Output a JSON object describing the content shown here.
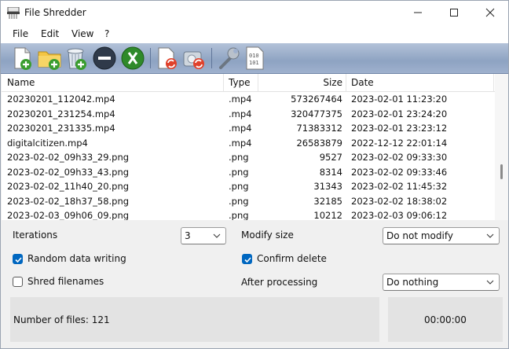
{
  "window": {
    "title": "File Shredder"
  },
  "menu": [
    "File",
    "Edit",
    "View",
    "?"
  ],
  "toolbar": {
    "buttons": [
      "add-file-icon",
      "add-folder-icon",
      "add-recycle-bin-icon",
      "remove-icon",
      "clear-list-icon",
      "shred-files-icon",
      "shred-free-space-icon",
      "settings-wrench-icon",
      "binary-file-icon"
    ]
  },
  "list": {
    "columns": {
      "name": "Name",
      "type": "Type",
      "size": "Size",
      "date": "Date"
    },
    "rows": [
      {
        "name": "20230201_112042.mp4",
        "type": ".mp4",
        "size": "573267464",
        "date": "2023-02-01 11:23:20"
      },
      {
        "name": "20230201_231254.mp4",
        "type": ".mp4",
        "size": "320477375",
        "date": "2023-02-01 23:24:20"
      },
      {
        "name": "20230201_231335.mp4",
        "type": ".mp4",
        "size": "71383312",
        "date": "2023-02-01 23:23:12"
      },
      {
        "name": "digitalcitizen.mp4",
        "type": ".mp4",
        "size": "26583879",
        "date": "2022-12-12 22:01:14"
      },
      {
        "name": "2023-02-02_09h33_29.png",
        "type": ".png",
        "size": "9527",
        "date": "2023-02-02 09:33:30"
      },
      {
        "name": "2023-02-02_09h33_43.png",
        "type": ".png",
        "size": "8314",
        "date": "2023-02-02 09:33:46"
      },
      {
        "name": "2023-02-02_11h40_20.png",
        "type": ".png",
        "size": "31343",
        "date": "2023-02-02 11:45:32"
      },
      {
        "name": "2023-02-02_18h37_58.png",
        "type": ".png",
        "size": "32185",
        "date": "2023-02-02 18:38:02"
      },
      {
        "name": "2023-02-03_09h06_09.png",
        "type": ".png",
        "size": "10212",
        "date": "2023-02-03 09:06:12"
      }
    ]
  },
  "options": {
    "iterations_label": "Iterations",
    "iterations_value": "3",
    "random_label": "Random data writing",
    "random_checked": true,
    "shred_names_label": "Shred filenames",
    "shred_names_checked": false,
    "modify_size_label": "Modify size",
    "modify_size_value": "Do not modify",
    "confirm_label": "Confirm delete",
    "confirm_checked": true,
    "after_label": "After processing",
    "after_value": "Do nothing"
  },
  "status": {
    "files_text": "Number of files: 121",
    "timer": "00:00:00"
  },
  "colors": {
    "accent": "#0067c0",
    "toolbar": "#9fb1ce"
  }
}
